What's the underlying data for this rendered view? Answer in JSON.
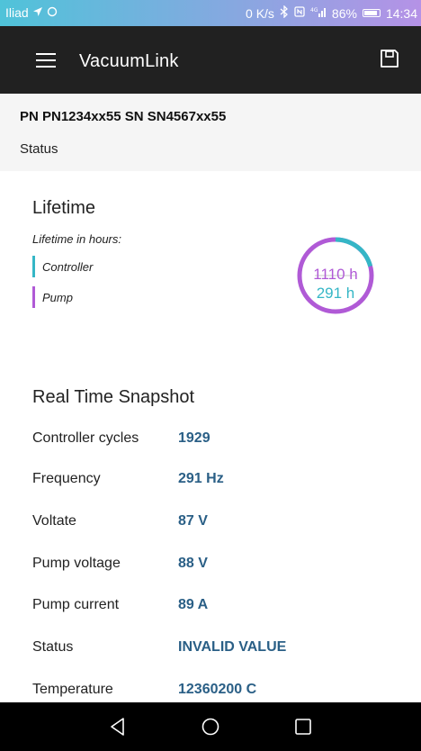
{
  "statusbar": {
    "carrier": "Iliad",
    "speed": "0 K/s",
    "battery": "86%",
    "time": "14:34"
  },
  "appbar": {
    "title": "VacuumLink"
  },
  "device": {
    "pn_sn": "PN PN1234xx55  SN SN4567xx55",
    "status": "Status"
  },
  "lifetime": {
    "title": "Lifetime",
    "subtitle": "Lifetime in hours:",
    "legend": [
      {
        "label": "Controller",
        "color": "#35b6c6"
      },
      {
        "label": "Pump",
        "color": "#b05ad6"
      }
    ],
    "gauge": {
      "pump_value": "1110 h",
      "controller_value": "291 h",
      "pump_color": "#b05ad6",
      "controller_color": "#35b6c6",
      "controller_fraction": 0.208
    }
  },
  "snapshot": {
    "title": "Real Time Snapshot",
    "rows": [
      {
        "label": "Controller cycles",
        "value": "1929"
      },
      {
        "label": "Frequency",
        "value": "291  Hz"
      },
      {
        "label": "Voltate",
        "value": "87  V"
      },
      {
        "label": "Pump voltage",
        "value": "88  V"
      },
      {
        "label": "Pump current",
        "value": "89  A"
      },
      {
        "label": "Status",
        "value": "INVALID VALUE"
      },
      {
        "label": "Temperature",
        "value": "12360200  C"
      }
    ]
  },
  "icons": {
    "menu": "menu-icon",
    "save": "save-icon",
    "back": "back-icon",
    "home": "home-icon",
    "recents": "recents-icon"
  }
}
